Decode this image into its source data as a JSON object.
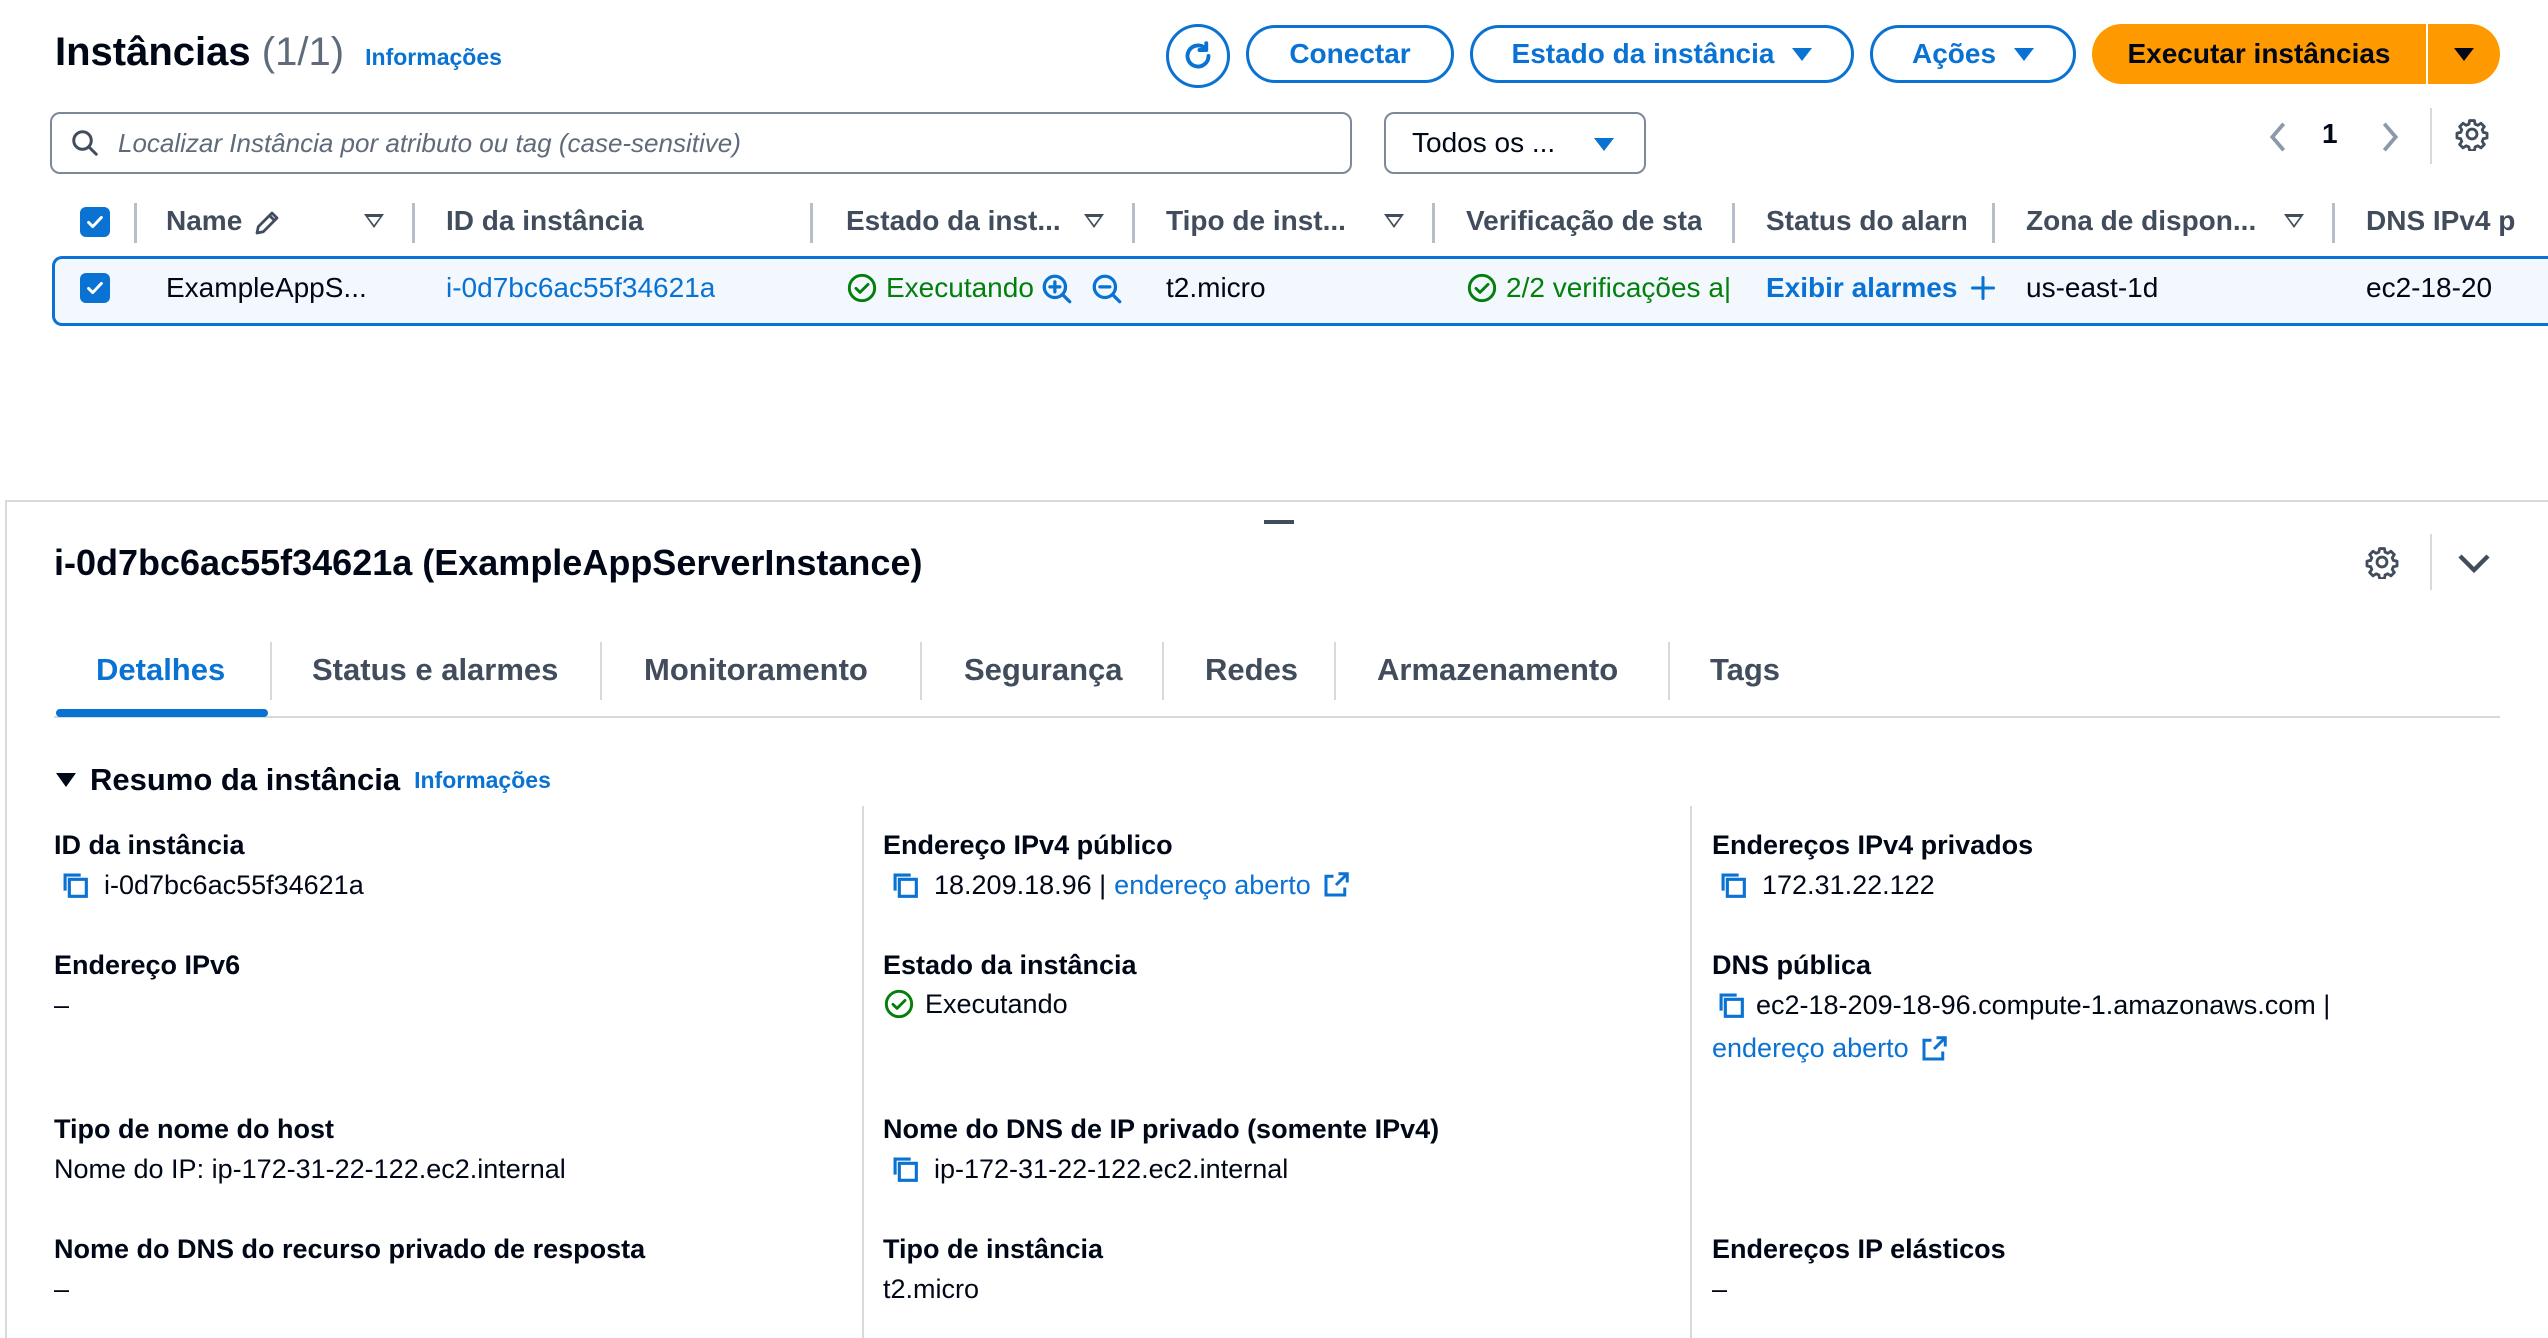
{
  "header": {
    "title": "Instâncias",
    "count": "(1/1)",
    "info_link": "Informações",
    "connect_label": "Conectar",
    "state_label": "Estado da instância",
    "actions_label": "Ações",
    "launch_label": "Executar instâncias"
  },
  "search": {
    "placeholder": "Localizar Instância por atributo ou tag (case-sensitive)"
  },
  "filter": {
    "selected": "Todos os ..."
  },
  "pagination": {
    "current_page": "1"
  },
  "table": {
    "columns": [
      "Name",
      "ID da instância",
      "Estado da inst...",
      "Tipo de inst...",
      "Verificação de stat",
      "Status do alarn",
      "Zona de dispon...",
      "DNS IPv4 p"
    ],
    "row": {
      "name": "ExampleAppS...",
      "instance_id": "i-0d7bc6ac55f34621a",
      "state": "Executando",
      "type": "t2.micro",
      "status_check": "2/2 verificações a|",
      "alarm": "Exibir alarmes",
      "zone": "us-east-1d",
      "dns": "ec2-18-20"
    }
  },
  "detail": {
    "title": "i-0d7bc6ac55f34621a (ExampleAppServerInstance)",
    "tabs": [
      "Detalhes",
      "Status e alarmes",
      "Monitoramento",
      "Segurança",
      "Redes",
      "Armazenamento",
      "Tags"
    ],
    "section": {
      "title": "Resumo da instância",
      "info_link": "Informações"
    },
    "fields": {
      "instance_id_label": "ID da instância",
      "instance_id_value": "i-0d7bc6ac55f34621a",
      "ipv6_label": "Endereço IPv6",
      "ipv6_value": "–",
      "hostname_type_label": "Tipo de nome do host",
      "hostname_type_value": "Nome do IP: ip-172-31-22-122.ec2.internal",
      "private_dns_resource_label": "Nome do DNS do recurso privado de resposta",
      "private_dns_resource_value": "–",
      "public_ipv4_label": "Endereço IPv4 público",
      "public_ipv4_value": "18.209.18.96 |",
      "open_address": "endereço aberto",
      "state_label": "Estado da instância",
      "state_value": "Executando",
      "private_dns_label": "Nome do DNS de IP privado (somente IPv4)",
      "private_dns_value": "ip-172-31-22-122.ec2.internal",
      "instance_type_label": "Tipo de instância",
      "instance_type_value": "t2.micro",
      "private_ipv4_label": "Endereços IPv4 privados",
      "private_ipv4_value": "172.31.22.122",
      "public_dns_label": "DNS pública",
      "public_dns_value": "ec2-18-209-18-96.compute-1.amazonaws.com |",
      "public_dns_open": "endereço aberto",
      "elastic_ip_label": "Endereços IP elásticos",
      "elastic_ip_value": "–"
    }
  },
  "colors": {
    "link_blue": "#0972d3",
    "primary_orange": "#ff9900",
    "success_green": "#037f0c",
    "selected_row_bg": "#f2f8fd"
  },
  "icons": [
    "refresh-icon",
    "search-icon",
    "chevron-left-icon",
    "chevron-right-icon",
    "gear-icon",
    "pencil-icon",
    "zoom-in-icon",
    "zoom-out-icon",
    "check-circle-icon",
    "plus-icon",
    "chevron-down-icon",
    "copy-icon",
    "external-link-icon"
  ]
}
